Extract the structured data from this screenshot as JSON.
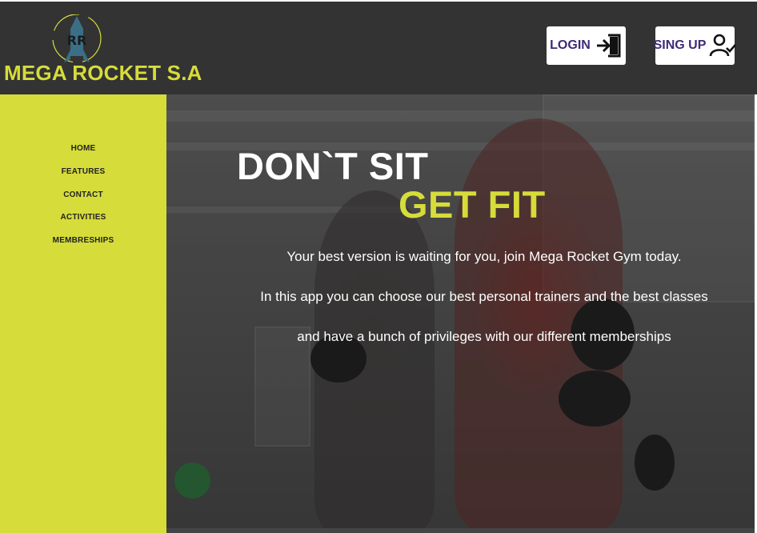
{
  "header": {
    "brand": "MEGA ROCKET S.A",
    "login_label": "LOGIN",
    "signup_label": "SING UP",
    "login_icon": "login-arrow-door-icon",
    "signup_icon": "user-check-icon"
  },
  "sidebar": {
    "items": [
      {
        "label": "HOME"
      },
      {
        "label": "FEATURES"
      },
      {
        "label": "CONTACT"
      },
      {
        "label": "ACTIVITIES"
      },
      {
        "label": "MEMBRESHIPS"
      }
    ]
  },
  "hero": {
    "title": "DON`T SIT",
    "subtitle": "GET FIT",
    "paragraph_1": "Your best version is waiting for you, join Mega Rocket Gym today.",
    "paragraph_2": "In this app you can choose our best personal trainers and the best classes and have a bunch of privileges with our different memberships"
  },
  "colors": {
    "accent": "#d6dc3a",
    "header_bg": "#333333",
    "button_text": "#3e2a78"
  }
}
